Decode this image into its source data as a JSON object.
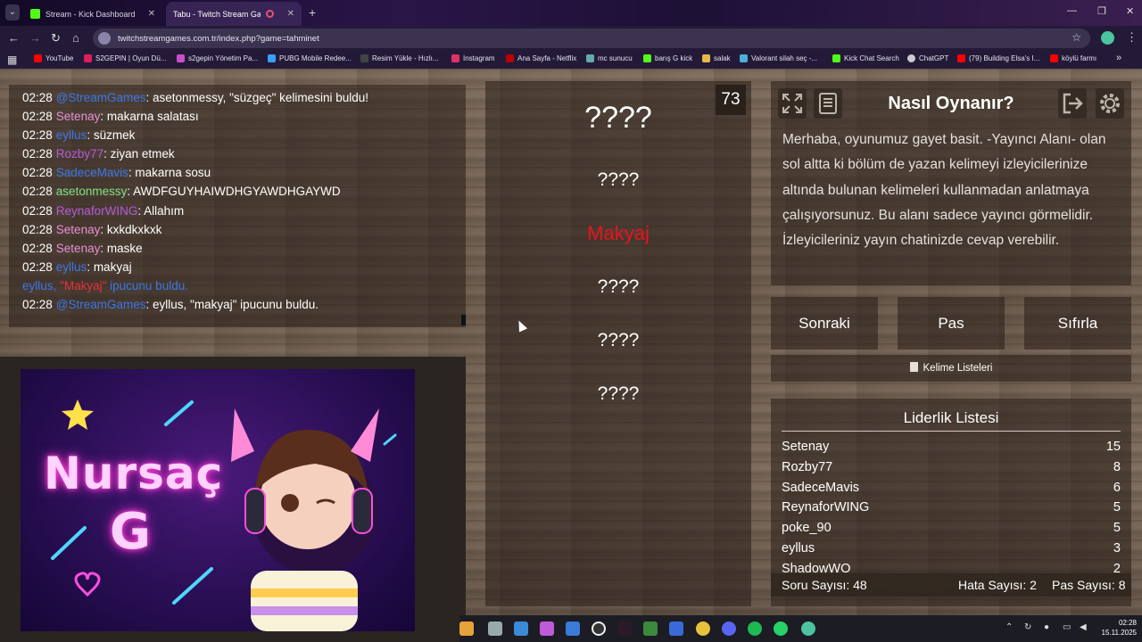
{
  "browser": {
    "tabs": [
      {
        "title": "Stream - Kick Dashboard",
        "active": false
      },
      {
        "title": "Tabu - Twitch Stream Game",
        "active": true
      }
    ],
    "url": "twitchstreamgames.com.tr/index.php?game=tahminet",
    "bookmarks": [
      "YouTube",
      "S2GEPIN | Oyun Dü...",
      "s2gepin Yönetim Pa...",
      "PUBG Mobile Redee...",
      "Resim Yükle - Hızlı...",
      "Instagram",
      "Ana Sayfa - Netflix",
      "mc sunucu",
      "barış G kick",
      "salak",
      "Valorant silah seç -...",
      "Kick Chat Search",
      "ChatGPT",
      "(79) Building Elsa's I...",
      "köylü farmı"
    ]
  },
  "chat": {
    "messages": [
      {
        "time": "02:28",
        "user": "@StreamGames",
        "color": "#3a78e8",
        "text": ": asetonmessy, \"süzgeç\" kelimesini buldu!"
      },
      {
        "time": "02:28",
        "user": "Setenay",
        "color": "#e78fd6",
        "text": ": makarna salatası"
      },
      {
        "time": "02:28",
        "user": "eyllus",
        "color": "#3a78e8",
        "text": ": süzmek"
      },
      {
        "time": "02:28",
        "user": "Rozby77",
        "color": "#b45ad8",
        "text": ": ziyan etmek"
      },
      {
        "time": "02:28",
        "user": "SadeceMavis",
        "color": "#3a78e8",
        "text": ": makarna sosu"
      },
      {
        "time": "02:28",
        "user": "asetonmessy",
        "color": "#7fe07f",
        "text": ": AWDFGUYHAIWDHGYAWDHGAYWD"
      },
      {
        "time": "02:28",
        "user": "ReynaforWING",
        "color": "#b45ad8",
        "text": ": Allahım"
      },
      {
        "time": "02:28",
        "user": "Setenay",
        "color": "#e78fd6",
        "text": ": kxkdkxkxk"
      },
      {
        "time": "02:28",
        "user": "Setenay",
        "color": "#e78fd6",
        "text": ": maske"
      },
      {
        "time": "02:28",
        "user": "eyllus",
        "color": "#3a78e8",
        "text": ": makyaj"
      }
    ],
    "notice": {
      "prefix": "eyllus, ",
      "hint": "\"Makyaj\"",
      "suffix": " ipucunu buldu."
    },
    "last": {
      "time": "02:28",
      "user": "@StreamGames",
      "color": "#3a78e8",
      "text": ": eyllus, \"makyaj\" ipucunu buldu."
    }
  },
  "stream_overlay": {
    "name_line1": "Nursaç",
    "name_line2": "G"
  },
  "board": {
    "timer": "73",
    "main_word": "????",
    "hints": [
      "????",
      "Makyaj",
      "????",
      "????",
      "????"
    ]
  },
  "howto": {
    "title": "Nasıl Oynanır?",
    "text": "Merhaba, oyunumuz gayet basit. -Yayıncı Alanı- olan sol altta ki bölüm de yazan kelimeyi izleyicilerinize altında bulunan kelimeleri kullanmadan anlatmaya çalışıyorsunuz. Bu alanı sadece yayıncı görmelidir. İzleyicileriniz yayın chatinizde cevap verebilir."
  },
  "actions": {
    "next": "Sonraki",
    "pass": "Pas",
    "reset": "Sıfırla"
  },
  "word_lists": {
    "label": "Kelime Listeleri"
  },
  "leaderboard": {
    "title": "Liderlik Listesi",
    "rows": [
      {
        "name": "Setenay",
        "score": "15"
      },
      {
        "name": "Rozby77",
        "score": "8"
      },
      {
        "name": "SadeceMavis",
        "score": "6"
      },
      {
        "name": "ReynaforWING",
        "score": "5"
      },
      {
        "name": "poke_90",
        "score": "5"
      },
      {
        "name": "eyllus",
        "score": "3"
      },
      {
        "name": "ShadowWO",
        "score": "2"
      }
    ]
  },
  "stats": {
    "questions": "Soru Sayısı: 48",
    "errors": "Hata Sayısı: 2",
    "passes": "Pas Sayısı: 8"
  },
  "taskbar": {
    "time": "02:28",
    "date": "15.11.2025"
  }
}
